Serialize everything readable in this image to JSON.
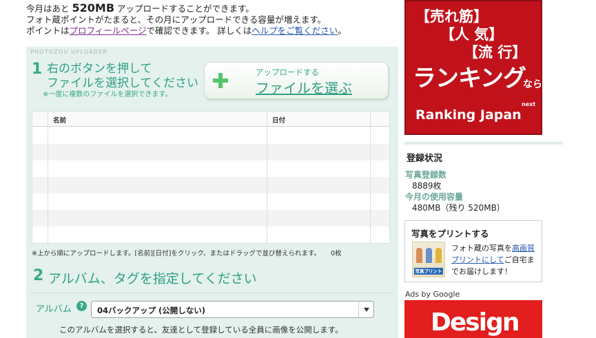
{
  "info": {
    "line1_prefix": "今月はあと",
    "line1_amount": "520MB",
    "line1_suffix": "アップロードすることができます。",
    "line2": "フォト蔵ポイントがたまると、その月にアップロードできる容量が増えます。",
    "line3_prefix": "ポイントは",
    "profile_link": "プロフィールページ",
    "line3_mid": "で確認できます。 詳しくは",
    "help_link": "ヘルプをご覧ください",
    "line3_end": "。"
  },
  "uploader": {
    "label": "PHOTOZOU UPLOADER",
    "step1": {
      "num": "1",
      "title_line1": "右のボタンを押して",
      "title_line2": "ファイルを選択してください",
      "note": "※一度に複数のファイルを選択できます。"
    },
    "select_button": {
      "small_label": "アップロードする",
      "big_label": "ファイルを選ぶ",
      "icon": "plus-icon"
    },
    "table": {
      "columns": [
        "名前",
        "日付"
      ],
      "rows": [],
      "note": "※上から順にアップロードします。[名前][日付]をクリック、またはドラッグで並び替えられます。",
      "count": "0枚"
    },
    "step2": {
      "num": "2",
      "title": "アルバム、タグを指定してください"
    },
    "album": {
      "label": "アルバム",
      "help_icon": "?",
      "selected": "04バックアップ (公開しない)",
      "note": "このアルバムを選択すると、友達として登録している全員に画像を公開します。"
    }
  },
  "sidebar": {
    "ranking_ad": {
      "line1": "【売れ筋】",
      "line2": "【人 気】",
      "line3": "【流 行】",
      "line4": "ランキング",
      "line4_suffix": "なら",
      "next": "next",
      "brand": "Ranking Japan"
    },
    "registration": {
      "title": "登録状況",
      "photos_label": "写真登録数",
      "photos_value": "8889枚",
      "usage_label": "今月の使用容量",
      "usage_value": "480MB（残り 520MB）"
    },
    "print": {
      "title": "写真をプリントする",
      "badge": "写真プリント",
      "text_prefix": "フォト蔵の写真を",
      "link": "高画質プリントにして",
      "text_suffix": "ご自宅までお届けします！"
    },
    "ads_label": "Ads by Google",
    "design_ad": "Design"
  }
}
